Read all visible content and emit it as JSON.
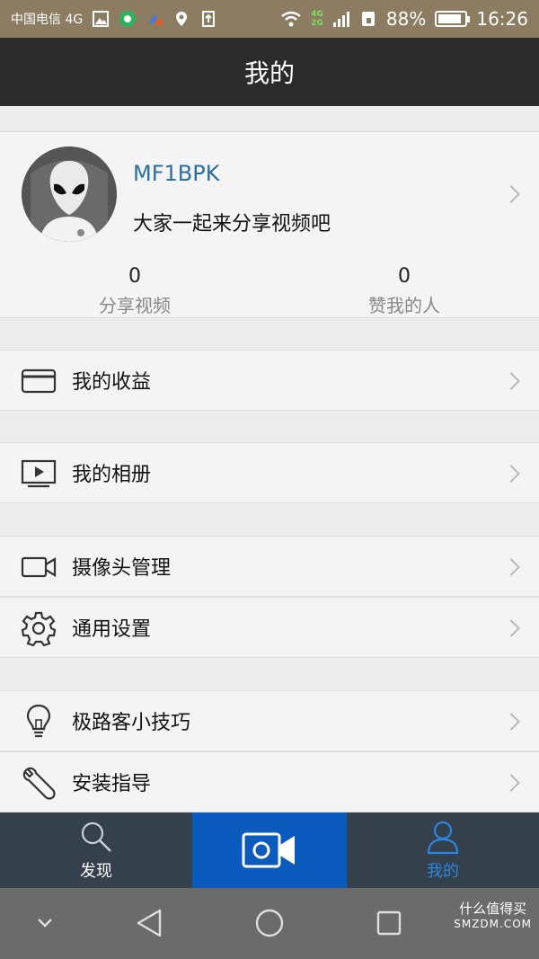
{
  "status_bar": {
    "carrier": "中国电信 4G",
    "network_top": "4G",
    "network_bottom": "2G",
    "battery_percent": "88%",
    "battery_level": 0.88,
    "time": "16:26"
  },
  "title": "我的",
  "profile": {
    "username": "MF1BPK",
    "bio": "大家一起来分享视频吧",
    "stats": [
      {
        "value": "0",
        "label": "分享视频"
      },
      {
        "value": "0",
        "label": "赞我的人"
      }
    ]
  },
  "menu": [
    {
      "label": "我的收益",
      "icon": "card-icon"
    },
    {
      "label": "我的相册",
      "icon": "video-album-icon"
    },
    {
      "label": "摄像头管理",
      "icon": "camera-icon"
    },
    {
      "label": "通用设置",
      "icon": "gear-icon"
    },
    {
      "label": "极路客小技巧",
      "icon": "lightbulb-icon"
    },
    {
      "label": "安装指导",
      "icon": "wrench-icon"
    }
  ],
  "tabs": [
    {
      "label": "发现",
      "icon": "search-icon"
    },
    {
      "label": "",
      "icon": "record-camera-icon"
    },
    {
      "label": "我的",
      "icon": "person-icon"
    }
  ],
  "watermark": {
    "line1": "什么值得买",
    "line2": "SMZDM.COM"
  },
  "colors": {
    "title_bar": "#2b2b2b",
    "tab_bar": "#34404b",
    "tab_active_bg": "#0a5bbd",
    "tab_active_text": "#2b86e0",
    "username": "#2a6ea4"
  }
}
